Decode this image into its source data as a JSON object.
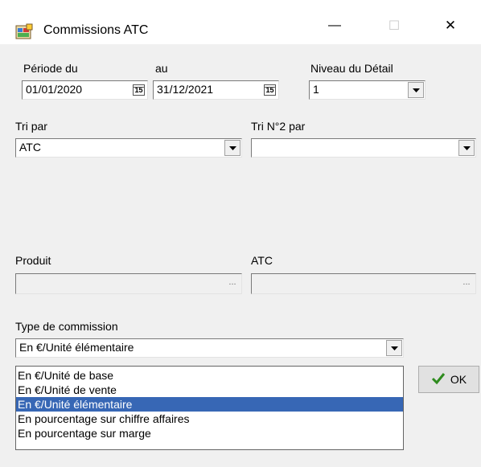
{
  "window": {
    "title": "Commissions ATC",
    "minimize_glyph": "—",
    "maximize_glyph": "☐",
    "close_glyph": "✕"
  },
  "periode": {
    "label_from": "Période du",
    "label_to": "au",
    "date_from": "01/01/2020",
    "date_to": "31/12/2021",
    "calendar_glyph": "15"
  },
  "niveau": {
    "label": "Niveau du Détail",
    "value": "1"
  },
  "tri": {
    "label": "Tri par",
    "value": "ATC"
  },
  "tri2": {
    "label": "Tri N°2 par",
    "value": ""
  },
  "produit": {
    "label": "Produit",
    "value": "",
    "browse": "..."
  },
  "atc": {
    "label": "ATC",
    "value": "",
    "browse": "..."
  },
  "type_commission": {
    "label": "Type de commission",
    "value": "En €/Unité élémentaire",
    "options": [
      "En €/Unité de base",
      "En €/Unité de vente",
      "En €/Unité élémentaire",
      "En pourcentage sur chiffre affaires",
      "En pourcentage sur marge"
    ],
    "selected_index": 2
  },
  "ok_button": {
    "label": "OK"
  },
  "colors": {
    "selection": "#3767b5",
    "check": "#2e8b1e",
    "dialog_bg": "#f0f0f0"
  },
  "icons": [
    "app-icon",
    "minimize-icon",
    "maximize-icon",
    "close-icon",
    "calendar-icon",
    "dropdown-arrow-icon",
    "check-icon"
  ]
}
